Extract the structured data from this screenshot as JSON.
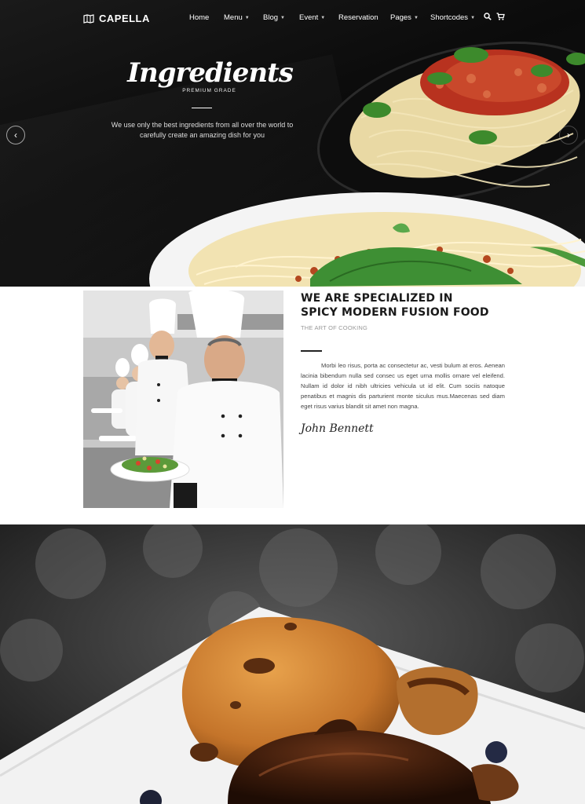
{
  "brand": {
    "name": "CAPELLA",
    "icon": "map-icon"
  },
  "nav": {
    "items": [
      {
        "label": "Home",
        "dropdown": false
      },
      {
        "label": "Menu",
        "dropdown": true
      },
      {
        "label": "Blog",
        "dropdown": true
      },
      {
        "label": "Event",
        "dropdown": true
      },
      {
        "label": "Reservation",
        "dropdown": false
      },
      {
        "label": "Pages",
        "dropdown": true
      },
      {
        "label": "Shortcodes",
        "dropdown": true
      }
    ],
    "icons": [
      "search-icon",
      "cart-icon"
    ]
  },
  "hero": {
    "title": "Ingredients",
    "subtitle": "PREMIUM GRADE",
    "description": "We use only the best ingredients from all over the world to carefully create an amazing dish for you",
    "prev_icon": "chevron-left-icon",
    "next_icon": "chevron-right-icon"
  },
  "about": {
    "title_line1": "WE ARE SPECIALIZED IN",
    "title_line2": "SPICY MODERN FUSION FOOD",
    "subtitle": "THE ART OF COOKING",
    "paragraph": "Morbi leo risus, porta ac consectetur ac, vesti bulum at eros. Aenean lacinia bibendum nulla sed consec us eget urna mollis ornare vel eleifend. Nullam id dolor id nibh ultricies vehicula ut id elit. Cum sociis natoque penatibus et magnis dis parturient monte siculus mus.Maecenas sed diam eget risus varius blandit sit amet non magna.",
    "signature": "John Bennett"
  },
  "colors": {
    "accent": "#ffffff",
    "dark": "#111111"
  }
}
